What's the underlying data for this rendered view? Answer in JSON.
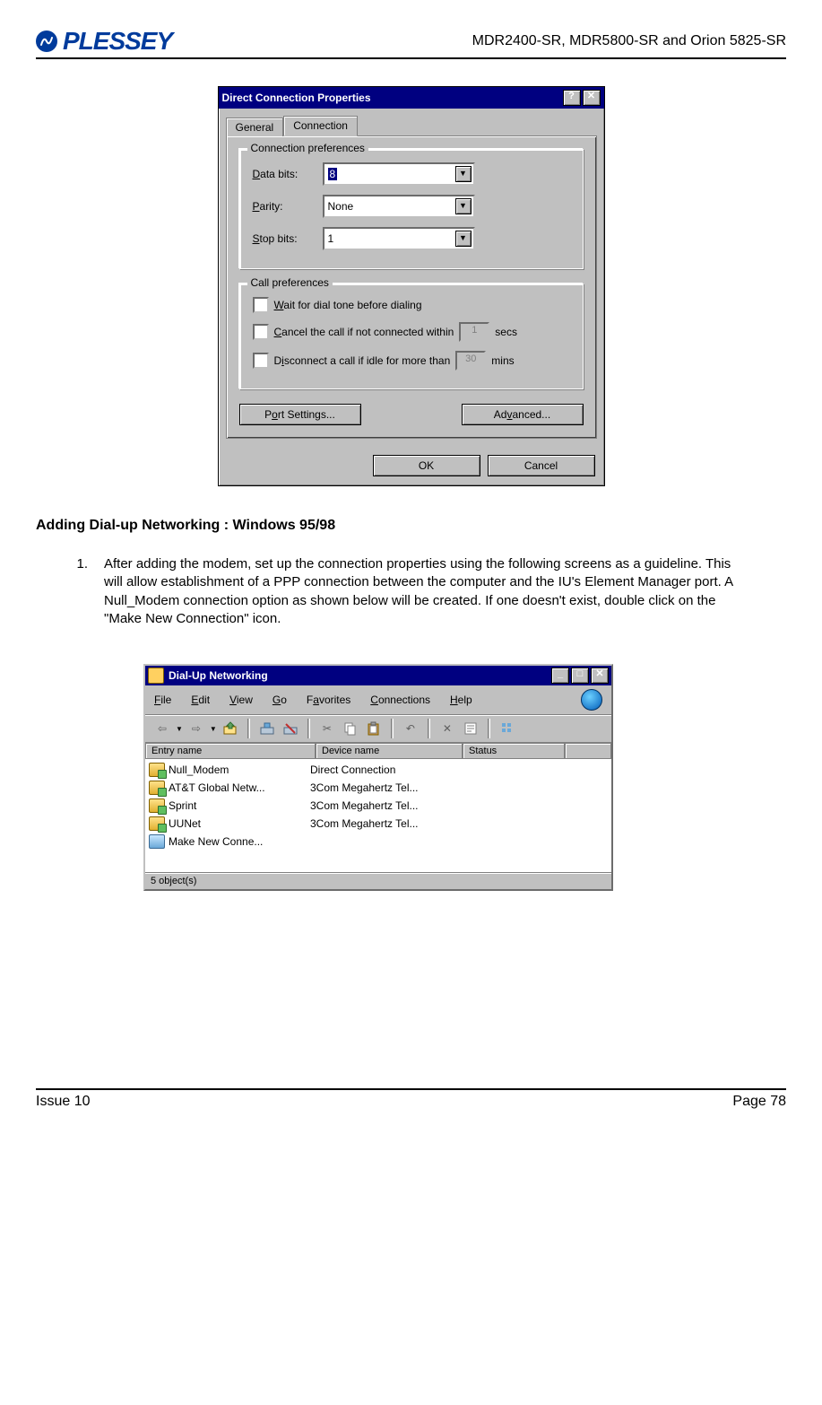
{
  "header": {
    "logo_text": "PLESSEY",
    "models": "MDR2400-SR, MDR5800-SR and Orion 5825-SR"
  },
  "dialog1": {
    "title": "Direct Connection Properties",
    "tabs": {
      "general": "General",
      "connection": "Connection"
    },
    "group_conn": {
      "title": "Connection preferences",
      "data_bits_lbl": "Data bits:",
      "data_bits_val": "8",
      "parity_lbl": "Parity:",
      "parity_val": "None",
      "stop_bits_lbl": "Stop bits:",
      "stop_bits_val": "1"
    },
    "group_call": {
      "title": "Call preferences",
      "wait": "Wait for dial tone before dialing",
      "cancel_pre": "Cancel the call if not connected within",
      "cancel_num": "1",
      "cancel_post": "secs",
      "disc_pre": "Disconnect a call if idle for more than",
      "disc_num": "30",
      "disc_post": "mins"
    },
    "buttons": {
      "port": "Port Settings...",
      "adv": "Advanced...",
      "ok": "OK",
      "cancel": "Cancel"
    }
  },
  "section": {
    "heading": "Adding Dial-up Networking : Windows 95/98",
    "step_num": "1.",
    "step_text": "After adding the modem, set up the connection properties using the following screens as a guideline.  This will allow establishment of a PPP connection between the computer and the IU's Element Manager port.  A Null_Modem connection option as shown below will be created.  If one doesn't exist, double click on the \"Make New Connection\" icon."
  },
  "explorer": {
    "title": "Dial-Up Networking",
    "menu": {
      "file": "File",
      "edit": "Edit",
      "view": "View",
      "go": "Go",
      "fav": "Favorites",
      "conn": "Connections",
      "help": "Help"
    },
    "cols": {
      "entry": "Entry name",
      "device": "Device name",
      "status": "Status"
    },
    "rows": [
      {
        "entry": "Null_Modem",
        "device": "Direct Connection",
        "status": ""
      },
      {
        "entry": "AT&T Global Netw...",
        "device": "3Com Megahertz Tel...",
        "status": ""
      },
      {
        "entry": "Sprint",
        "device": "3Com Megahertz Tel...",
        "status": ""
      },
      {
        "entry": "UUNet",
        "device": "3Com Megahertz Tel...",
        "status": ""
      },
      {
        "entry": "Make New Conne...",
        "device": "",
        "status": ""
      }
    ],
    "statusbar": "5 object(s)"
  },
  "footer": {
    "issue": "Issue 10",
    "page": "Page 78"
  }
}
